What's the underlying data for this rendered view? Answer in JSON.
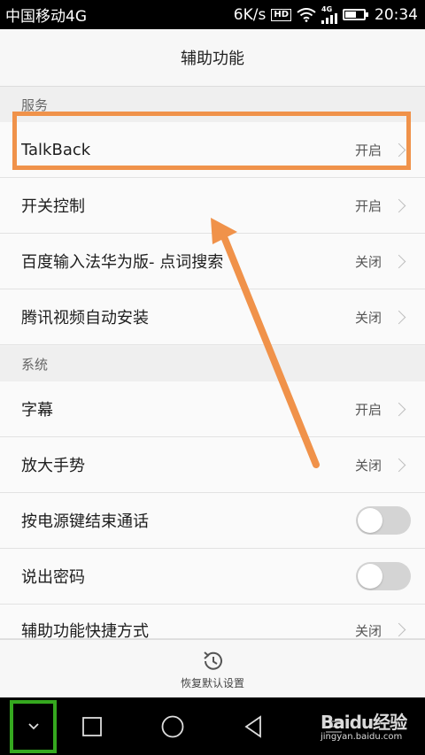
{
  "status_bar": {
    "carrier": "中国移动4G",
    "speed": "6K/s",
    "hd": "HD",
    "net": "4G",
    "time": "20:34"
  },
  "header": {
    "title": "辅助功能"
  },
  "services": {
    "header": "服务",
    "items": [
      {
        "label": "TalkBack",
        "status": "开启"
      },
      {
        "label": "开关控制",
        "status": "开启"
      },
      {
        "label": "百度输入法华为版- 点词搜索",
        "status": "关闭"
      },
      {
        "label": "腾讯视频自动安装",
        "status": "关闭"
      }
    ]
  },
  "system": {
    "header": "系统",
    "items": [
      {
        "label": "字幕",
        "status": "开启"
      },
      {
        "label": "放大手势",
        "status": "关闭"
      },
      {
        "label": "按电源键结束通话",
        "toggle": false
      },
      {
        "label": "说出密码",
        "toggle": false
      },
      {
        "label": "辅助功能快捷方式",
        "status": "关闭"
      }
    ]
  },
  "footer": {
    "restore_label": "恢复默认设置"
  },
  "watermark": {
    "main": "Baidu经验",
    "url": "jingyan.baidu.com"
  },
  "colors": {
    "highlight": "#f0924a",
    "nav_highlight": "#35a81f"
  },
  "battery_level": 0.6
}
